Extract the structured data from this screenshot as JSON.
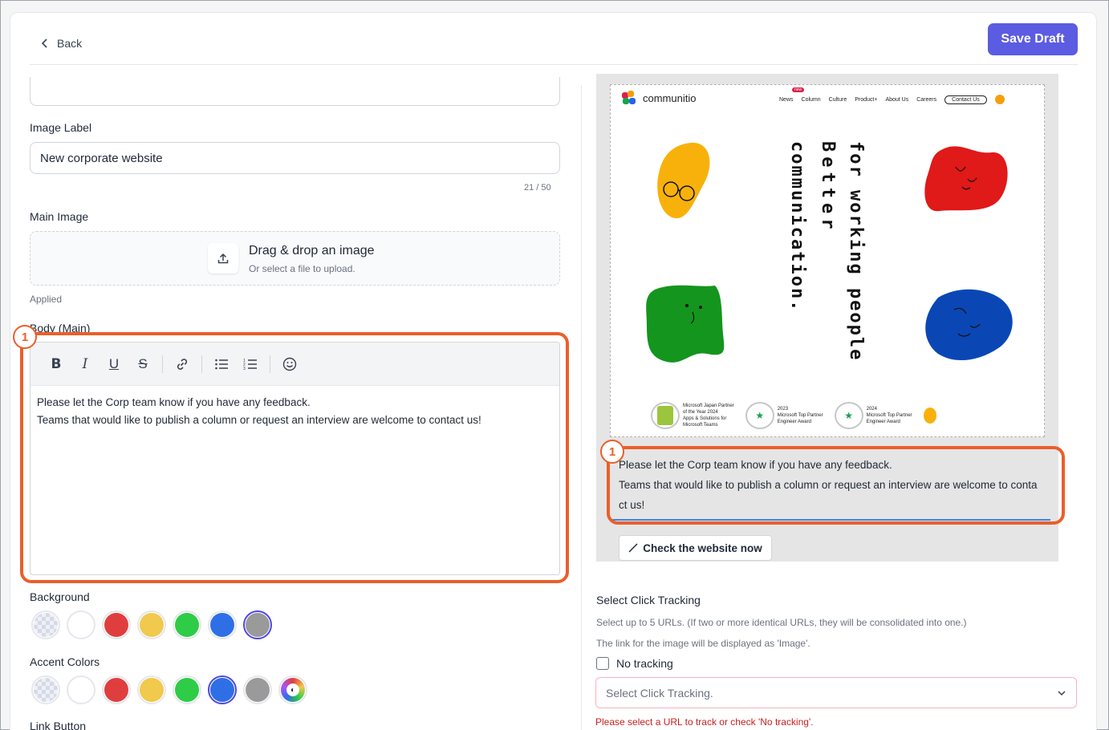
{
  "header": {
    "back_label": "Back",
    "save_label": "Save Draft"
  },
  "form": {
    "image_label": {
      "label": "Image Label",
      "value": "New corporate website",
      "counter": "21 / 50"
    },
    "main_image": {
      "label": "Main Image",
      "drop_title": "Drag & drop an image",
      "drop_sub": "Or select a file to upload.",
      "status": "Applied"
    },
    "body": {
      "label": "Body (Main)",
      "text_line1": "Please let the Corp team know if you have any feedback.",
      "text_line2": "Teams that would like to publish a column or request an interview are welcome to contact us!"
    },
    "background": {
      "label": "Background",
      "swatches": [
        "transparent",
        "#ffffff",
        "#e03e3e",
        "#f0c94d",
        "#2fcc47",
        "#2f6fe6",
        "#9a9a9a"
      ],
      "selected": "#9a9a9a"
    },
    "accent": {
      "label": "Accent Colors",
      "swatches": [
        "transparent",
        "#ffffff",
        "#e03e3e",
        "#f0c94d",
        "#2fcc47",
        "#2f6fe6",
        "#9a9a9a",
        "custom"
      ],
      "selected": "#2f6fe6"
    },
    "link_button": {
      "label": "Link Button"
    }
  },
  "annotation": {
    "number": "1",
    "color": "#ea5f2b"
  },
  "preview": {
    "site": {
      "logo": "communitio",
      "nav": [
        "News",
        "Column",
        "Culture",
        "Product+",
        "About Us",
        "Careers"
      ],
      "nav_new": "new",
      "contact": "Contact Us",
      "headline_1": "for working people",
      "headline_2": "Better",
      "headline_3": "communication.",
      "award_1": [
        "Microsoft Japan Partner",
        "of the Year 2024",
        "Apps & Solutions for",
        "Microsoft Teams"
      ],
      "award_2": [
        "2023",
        "Microsoft Top Partner",
        "Engineer Award"
      ],
      "award_3": [
        "2024",
        "Microsoft Top Partner",
        "Engineer Award"
      ]
    },
    "body_line1": "Please let the Corp team know if you have any feedback.",
    "body_line2": "Teams that would like to publish a column or request an interview are welcome to conta",
    "body_line3": "ct us!",
    "check_label": "Check the website now"
  },
  "tracking": {
    "title": "Select Click Tracking",
    "help1": "Select up to 5 URLs. (If two or more identical URLs, they will be consolidated into one.)",
    "help2": "The link for the image will be displayed as 'Image'.",
    "no_tracking": "No tracking",
    "placeholder": "Select Click Tracking.",
    "error": "Please select a URL to track or check 'No tracking'."
  }
}
